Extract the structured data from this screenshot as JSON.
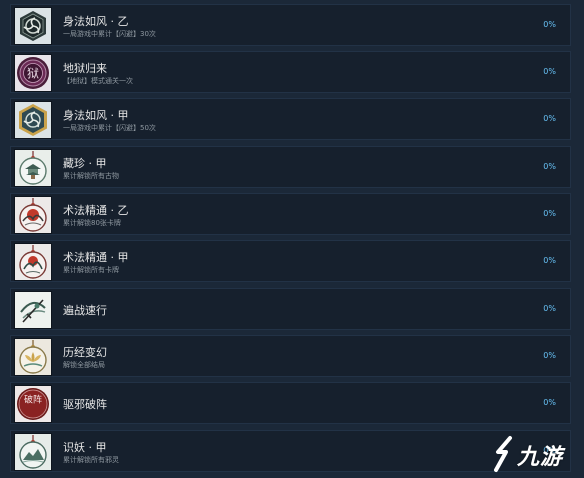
{
  "achievements": [
    {
      "title": "身法如风 · 乙",
      "description": "一局游戏中累计【闪避】30次",
      "percent": "0%",
      "icon": "triskelion-badge-icon",
      "bg": "#dbe3e6"
    },
    {
      "title": "地狱归来",
      "description": "【地狱】模式通关一次",
      "percent": "0%",
      "icon": "hell-seal-icon",
      "bg": "#e8e4ea"
    },
    {
      "title": "身法如风 · 甲",
      "description": "一局游戏中累计【闪避】50次",
      "percent": "0%",
      "icon": "triskelion-badge-gold-icon",
      "bg": "#dbe3e6"
    },
    {
      "title": "藏珍 · 甲",
      "description": "累计解锁所有古物",
      "percent": "0%",
      "icon": "pagoda-pendant-icon",
      "bg": "#e9eeea"
    },
    {
      "title": "术法精通 · 乙",
      "description": "累计解锁80张卡牌",
      "percent": "0%",
      "icon": "crane-pendant-icon",
      "bg": "#ece9e8"
    },
    {
      "title": "术法精通 · 甲",
      "description": "累计解锁所有卡牌",
      "percent": "0%",
      "icon": "crane-pendant-red-icon",
      "bg": "#eceae9"
    },
    {
      "title": "遍战速行",
      "description": "",
      "percent": "0%",
      "icon": "sword-swirl-icon",
      "bg": "#e6ebe8"
    },
    {
      "title": "历经变幻",
      "description": "解锁全部结局",
      "percent": "0%",
      "icon": "lotus-pendant-icon",
      "bg": "#ece8df"
    },
    {
      "title": "驱邪破阵",
      "description": "",
      "percent": "0%",
      "icon": "break-formation-seal-icon",
      "bg": "#e8e4e4"
    },
    {
      "title": "识妖 · 甲",
      "description": "累计解锁所有邪灵",
      "percent": "0%",
      "icon": "mountain-pendant-icon",
      "bg": "#e6ece9"
    }
  ],
  "seal_text": {
    "hell": "狱",
    "break": "破阵"
  },
  "watermark": {
    "text": "九游"
  }
}
